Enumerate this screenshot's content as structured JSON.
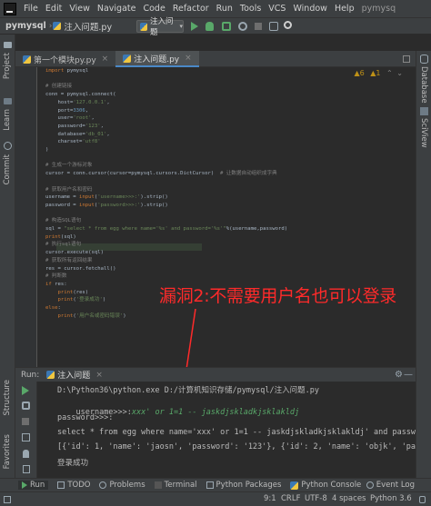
{
  "menubar": {
    "items": [
      "File",
      "Edit",
      "View",
      "Navigate",
      "Code",
      "Refactor",
      "Run",
      "Tools",
      "VCS",
      "Window",
      "Help"
    ],
    "window_title": "pymysq",
    "run_config": "注入问题",
    "run_config_caret": "▾"
  },
  "breadcrumb": {
    "project": "pymysql",
    "file": "注入问题.py"
  },
  "tabs": [
    {
      "label": "第一个模块py.py",
      "close": "×",
      "active": false
    },
    {
      "label": "注入问题.py",
      "close": "×",
      "active": true
    }
  ],
  "inspections": {
    "warnings": "▲6",
    "weak": "▲1",
    "up": "⌃",
    "down": "⌄"
  },
  "left_strip": {
    "project": "Project",
    "learn": "Learn",
    "commit": "Commit",
    "structure": "Structure",
    "favorites": "Favorites"
  },
  "right_strip": {
    "database": "Database",
    "sciview": "SciView"
  },
  "code_lines": [
    {
      "t": "import pymysql"
    },
    {
      "t": ""
    },
    {
      "t": "# 创建链接"
    },
    {
      "t": "conn = pymysql.connect("
    },
    {
      "t": "    host='127.0.0.1',"
    },
    {
      "t": "    port=3306,"
    },
    {
      "t": "    user='root',"
    },
    {
      "t": "    password='123',"
    },
    {
      "t": "    database='db_01',"
    },
    {
      "t": "    charset='utf8'"
    },
    {
      "t": ")"
    },
    {
      "t": ""
    },
    {
      "t": "# 生成一个游标对象"
    },
    {
      "t": "cursor = conn.cursor(cursor=pymysql.cursors.DictCursor)  # 让数据自动组织成字典"
    },
    {
      "t": ""
    },
    {
      "t": "# 获取用户名和密码"
    },
    {
      "t": "username = input('username>>>:').strip()"
    },
    {
      "t": "password = input('password>>>:').strip()"
    },
    {
      "t": ""
    },
    {
      "t": "# 构造SQL语句"
    },
    {
      "t": "sql = \"select * from egg where name='%s' and password='%s'\"%(username,password)"
    },
    {
      "t": "print(sql)"
    },
    {
      "t": "# 执行sql语句"
    },
    {
      "t": "cursor.execute(sql)"
    },
    {
      "t": "# 获取所有返回结果"
    },
    {
      "t": "res = cursor.fetchall()"
    },
    {
      "t": "# 判断数"
    },
    {
      "t": "if res:"
    },
    {
      "t": "    print(res)"
    },
    {
      "t": "    print('登录成功')"
    },
    {
      "t": "else:"
    },
    {
      "t": "    print('用户名或密码错误')"
    },
    {
      "t": ""
    }
  ],
  "annotation": "漏洞2:不需要用户名也可以登录",
  "run_panel": {
    "label": "Run:",
    "tab": "注入问题",
    "close": "×",
    "gear": "⚙",
    "minimize": "—"
  },
  "console": {
    "cmd": "D:\\Python36\\python.exe D:/计算机知识存储/pymysql/注入问题.py",
    "username_prompt": "username>>>:",
    "username_input": "xxx' or 1=1 -- jaskdjskladkjsklakldj",
    "password_prompt": "password>>>:",
    "sql_echo": "select * from egg where name='xxx' or 1=1 -- jaskdjskladkjsklakldj' and passw",
    "result": "[{'id': 1, 'name': 'jaosn', 'password': '123'}, {'id': 2, 'name': 'objk', 'pass",
    "login_ok": "登录成功"
  },
  "bottom_tools": {
    "run": "Run",
    "todo": "TODO",
    "problems": "Problems",
    "terminal": "Terminal",
    "packages": "Python Packages",
    "console": "Python Console",
    "event_log": "Event Log"
  },
  "status": {
    "position": "9:1",
    "line_sep": "CRLF",
    "encoding": "UTF-8",
    "indent": "4 spaces",
    "interpreter": "Python 3.6"
  },
  "colors": {
    "background": "#2b2b2b",
    "chrome": "#3c3f41",
    "annotation": "#ff2a2a",
    "accent": "#4a88c7",
    "run_green": "#59a869"
  }
}
